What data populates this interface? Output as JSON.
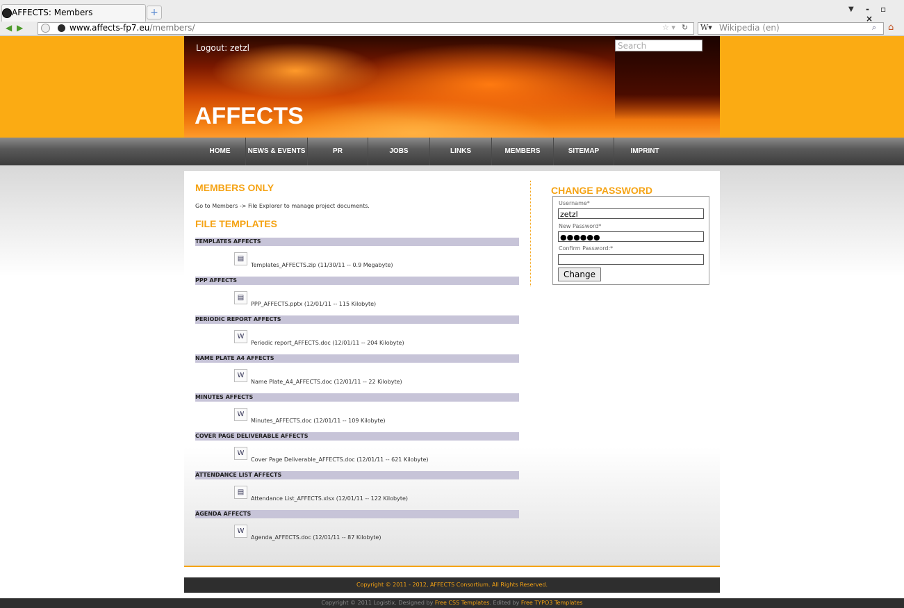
{
  "browser": {
    "tab_title": "AFFECTS: Members",
    "tab_close": "×",
    "new_tab": "+",
    "url_domain": "www.affects-fp7.eu",
    "url_path": "/members/",
    "search_engine": "W▾",
    "search_placeholder": "Wikipedia (en)",
    "window_controls": "-ᴇ×"
  },
  "header": {
    "logout": "Logout: zetzl",
    "search_placeholder": "Search",
    "site_title": "AFFECTS"
  },
  "menu": [
    "HOME",
    "NEWS & EVENTS",
    "PR",
    "JOBS",
    "LINKS",
    "MEMBERS",
    "SITEMAP",
    "IMPRINT"
  ],
  "main": {
    "members_heading": "MEMBERS ONLY",
    "intro": "Go to Members -> File Explorer to manage project documents.",
    "templates_heading": "FILE TEMPLATES",
    "sections": [
      {
        "title": "TEMPLATES AFFECTS",
        "file": "Templates_AFFECTS.zip",
        "meta": "(11/30/11 -- 0.9 Megabyte)",
        "icon": "zip-file-icon"
      },
      {
        "title": "PPP AFFECTS",
        "file": "PPP_AFFECTS.pptx",
        "meta": "(12/01/11 -- 115 Kilobyte)",
        "icon": "generic-file-icon"
      },
      {
        "title": "PERIODIC REPORT AFFECTS",
        "file": "Periodic report_AFFECTS.doc",
        "meta": "(12/01/11 -- 204 Kilobyte)",
        "icon": "word-doc-icon"
      },
      {
        "title": "NAME PLATE A4 AFFECTS",
        "file": "Name Plate_A4_AFFECTS.doc",
        "meta": "(12/01/11 -- 22 Kilobyte)",
        "icon": "word-doc-icon"
      },
      {
        "title": "MINUTES AFFECTS",
        "file": "Minutes_AFFECTS.doc",
        "meta": "(12/01/11 -- 109 Kilobyte)",
        "icon": "word-doc-icon"
      },
      {
        "title": "COVER PAGE DELIVERABLE AFFECTS",
        "file": "Cover Page Deliverable_AFFECTS.doc",
        "meta": "(12/01/11 -- 621 Kilobyte)",
        "icon": "word-doc-icon"
      },
      {
        "title": "ATTENDANCE LIST AFFECTS",
        "file": "Attendance List_AFFECTS.xlsx",
        "meta": "(12/01/11 -- 122 Kilobyte)",
        "icon": "generic-file-icon"
      },
      {
        "title": "AGENDA AFFECTS",
        "file": "Agenda_AFFECTS.doc",
        "meta": "(12/01/11 -- 87 Kilobyte)",
        "icon": "word-doc-icon"
      }
    ]
  },
  "password_form": {
    "title": "CHANGE PASSWORD",
    "username_label": "Username*",
    "username_value": "zetzl",
    "new_password_label": "New Password*",
    "new_password_value": "●●●●●●",
    "confirm_label": "Confirm Password:*",
    "confirm_value": "",
    "button": "Change"
  },
  "footer": {
    "copyright": "Copyright © 2011 - 2012, AFFECTS Consortium. All Rights Reserved.",
    "bottom_prefix": "Copyright © 2011 Logistix. Designed by",
    "bottom_link1": "Free CSS Templates",
    "bottom_mid": ". Edited by",
    "bottom_link2": "Free TYPO3 Templates"
  },
  "colors": {
    "accent": "#f5a314",
    "band": "#fbab13",
    "section_bar": "#c7c4d8"
  }
}
